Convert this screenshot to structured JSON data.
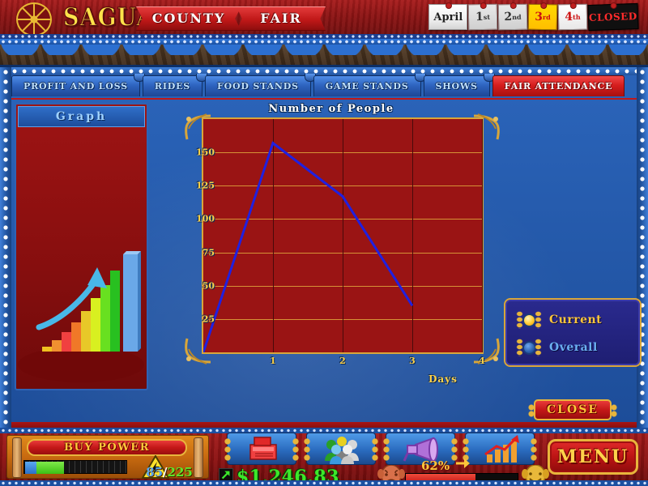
{
  "banner": {
    "logo_icon": "ferris-wheel-icon",
    "title_main": "SAGUARO",
    "title_ribbon1": "COUNTY",
    "title_ribbon2": "FAIR"
  },
  "date_selector": {
    "month": "April",
    "days": [
      {
        "label": "1",
        "suffix": "st",
        "state": "past"
      },
      {
        "label": "2",
        "suffix": "nd",
        "state": "past"
      },
      {
        "label": "3",
        "suffix": "rd",
        "state": "selected"
      },
      {
        "label": "4",
        "suffix": "th",
        "state": "future"
      }
    ],
    "closed_label": "CLOSED"
  },
  "tabs": [
    {
      "label": "PROFIT AND LOSS",
      "active": false
    },
    {
      "label": "RIDES",
      "active": false
    },
    {
      "label": "FOOD STANDS",
      "active": false
    },
    {
      "label": "GAME STANDS",
      "active": false
    },
    {
      "label": "SHOWS",
      "active": false
    },
    {
      "label": "FAIR ATTENDANCE",
      "active": true
    }
  ],
  "sidebar": {
    "header": "Graph",
    "graphic_icon": "ascending-bar-chart-illustration"
  },
  "legend": {
    "options": [
      {
        "label": "Current",
        "selected": true
      },
      {
        "label": "Overall",
        "selected": false
      }
    ]
  },
  "buttons": {
    "close": "CLOSE",
    "menu": "MENU",
    "buy_power": "BUY POWER"
  },
  "hud": {
    "power": {
      "current": "85",
      "separator": "/",
      "max": "225",
      "icon": "lightning-bolt-icon",
      "fill_percent": 38
    },
    "money": {
      "amount": "$1,246.83",
      "icon": "cash-register-icon",
      "trend_icon": "up-arrow-icon"
    },
    "attendance": {
      "icon": "crowd-people-icon"
    },
    "advertising": {
      "icon": "megaphone-icon"
    },
    "statistics": {
      "icon": "bar-chart-icon"
    },
    "happiness": {
      "percent_label": "62%",
      "fill_percent": 62,
      "sad_icon": "sad-mask-icon",
      "happy_icon": "happy-mask-icon",
      "arrow_icon": "right-arrow-icon"
    }
  },
  "chart_data": {
    "type": "line",
    "title": "Number of People",
    "xlabel": "Days",
    "ylabel": "",
    "x": [
      0,
      1,
      2,
      3
    ],
    "series": [
      {
        "name": "Current",
        "values": [
          0,
          157,
          117,
          35
        ],
        "color": "#2020e0"
      }
    ],
    "xticks": [
      "1",
      "2",
      "3",
      "4"
    ],
    "yticks": [
      25,
      50,
      75,
      100,
      125,
      150
    ],
    "xlim": [
      0,
      4
    ],
    "ylim": [
      0,
      175
    ],
    "grid": true,
    "plot_bg": "#9a1414",
    "grid_color": "#e0a83c",
    "legend_position": "right"
  }
}
